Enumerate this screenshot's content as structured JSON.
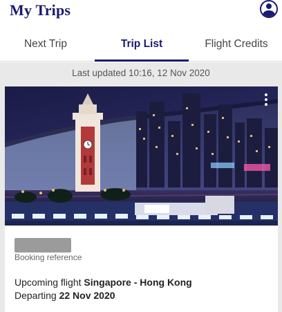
{
  "header": {
    "title": "My Trips",
    "profile_icon": "user-profile-icon"
  },
  "tabs": [
    {
      "label": "Next Trip",
      "active": false
    },
    {
      "label": "Trip List",
      "active": true
    },
    {
      "label": "Flight Credits",
      "active": false
    }
  ],
  "status": {
    "last_updated": "Last updated 10:16, 12 Nov 2020"
  },
  "trip": {
    "image_subject": "Hong Kong harbour skyline at night with clock tower",
    "menu_icon": "more-vertical-icon",
    "booking_reference_label": "Booking reference",
    "upcoming_prefix": "Upcoming flight",
    "route": "Singapore - Hong Kong",
    "departing_prefix": "Departing",
    "departing_date": "22 Nov 2020"
  },
  "colors": {
    "brand": "#1a1a6e",
    "background": "#e9e9e9"
  }
}
